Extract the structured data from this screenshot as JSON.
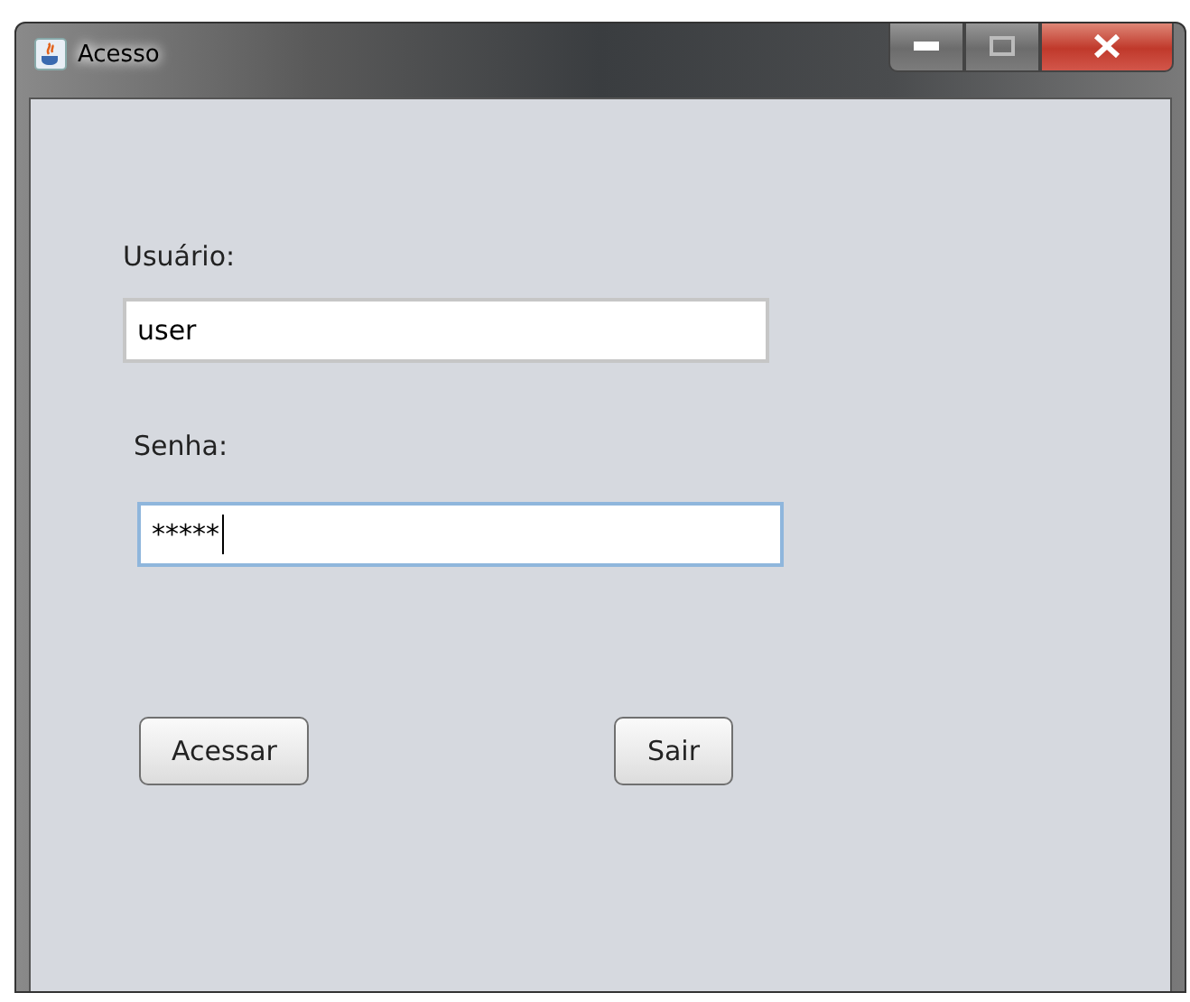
{
  "window": {
    "title": "Acesso"
  },
  "form": {
    "username_label": "Usuário:",
    "username": {
      "value": "user",
      "focused": false
    },
    "password_label": "Senha:",
    "password": {
      "value": "*****",
      "focused": true
    }
  },
  "buttons": [
    "Acessar",
    "Sair"
  ]
}
